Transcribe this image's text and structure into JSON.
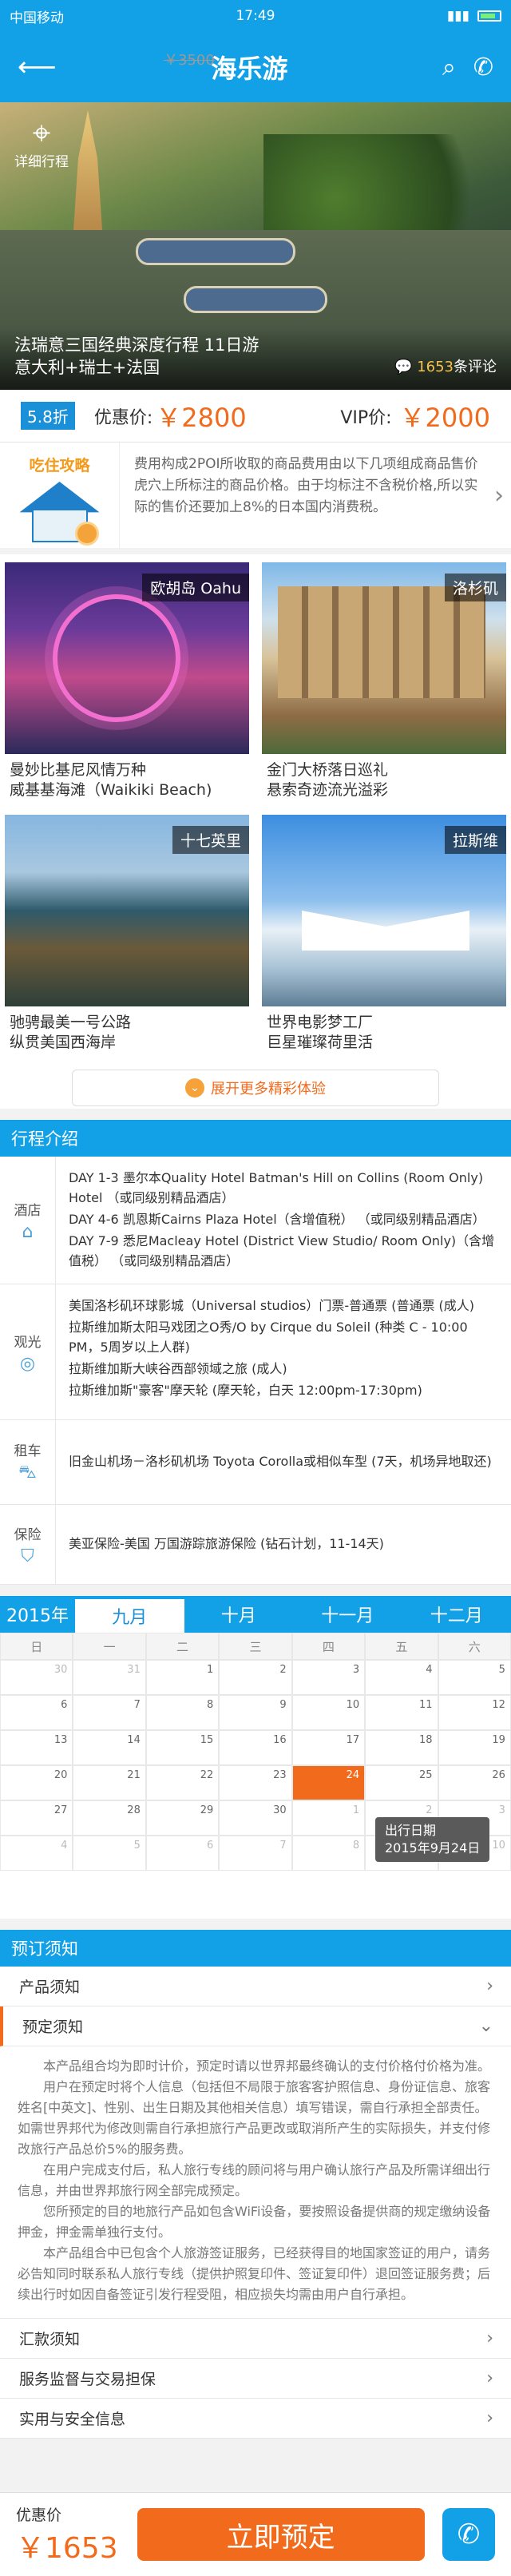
{
  "status": {
    "carrier": "中国移动",
    "time": "17:49"
  },
  "nav": {
    "title": "海乐游",
    "back_icon": "arrow-left-icon",
    "search_icon": "search-icon",
    "phone_icon": "phone-icon"
  },
  "hero": {
    "route_label": "详细行程",
    "title_line1": "法瑞意三国经典深度行程  11日游",
    "title_line2": "意大利+瑞士+法国",
    "comment_count": "1653",
    "comment_suffix": "条评论"
  },
  "price": {
    "discount": "5.8折",
    "deal_label": "优惠价:",
    "deal_price": "￥2800",
    "original_price": "￥3500",
    "vip_label": "VIP价:",
    "vip_price": "￥2000"
  },
  "tips": {
    "title": "吃住攻略",
    "text": "费用构成2POI所收取的商品费用由以下几项组成商品售价 虎穴上所标注的商品价格。由于均标注不含税价格,所以实际的售价还要加上8%的日本国内消费税。"
  },
  "highlights": [
    {
      "tag": "欧胡岛 Oahu",
      "line1": "曼妙比基尼风情万种",
      "line2": "威基基海滩（Waikiki Beach)"
    },
    {
      "tag": "洛杉矶",
      "line1": "金门大桥落日巡礼",
      "line2": "悬索奇迹流光溢彩"
    },
    {
      "tag": "十七英里",
      "line1": "驰骋最美一号公路",
      "line2": "纵贯美国西海岸"
    },
    {
      "tag": "拉斯维",
      "line1": "世界电影梦工厂",
      "line2": "巨星璀璨荷里活"
    }
  ],
  "more_label": "展开更多精彩体验",
  "itinerary": {
    "title": "行程介绍",
    "hotel": {
      "label": "酒店",
      "lines": [
        "DAY 1-3 墨尔本Quality Hotel Batman's Hill on Collins (Room Only) Hotel （或同级别精品酒店）",
        "DAY 4-6 凯恩斯Cairns Plaza Hotel（含增值税） （或同级别精品酒店）",
        "DAY 7-9 悉尼Macleay Hotel (District View Studio/ Room Only)（含增值税） （或同级别精品酒店）"
      ]
    },
    "sight": {
      "label": "观光",
      "lines": [
        "美国洛杉矶环球影城（Universal studios）门票-普通票 (普通票 (成人)",
        "拉斯维加斯太阳马戏团之O秀/O by Cirque du Soleil (种类 C - 10:00 PM，5周岁以上人群)",
        "拉斯维加斯大峡谷西部领域之旅 (成人)",
        "拉斯维加斯\"豪客\"摩天轮 (摩天轮，白天 12:00pm-17:30pm)"
      ]
    },
    "car": {
      "label": "租车",
      "lines": [
        "旧金山机场－洛杉矶机场 Toyota Corolla或相似车型 (7天，机场异地取还)"
      ]
    },
    "ins": {
      "label": "保险",
      "lines": [
        "美亚保险-美国 万国游踪旅游保险 (钻石计划，11-14天)"
      ]
    }
  },
  "calendar": {
    "year": "2015年",
    "months": [
      "九月",
      "十月",
      "十一月",
      "十二月"
    ],
    "weekdays": [
      "日",
      "一",
      "二",
      "三",
      "四",
      "五",
      "六"
    ],
    "rows": [
      [
        "30",
        "31",
        "1",
        "2",
        "3",
        "4",
        "5"
      ],
      [
        "6",
        "7",
        "8",
        "9",
        "10",
        "11",
        "12"
      ],
      [
        "13",
        "14",
        "15",
        "16",
        "17",
        "18",
        "19"
      ],
      [
        "20",
        "21",
        "22",
        "23",
        "24",
        "25",
        "26"
      ],
      [
        "27",
        "28",
        "29",
        "30",
        "1",
        "2",
        "3"
      ],
      [
        "4",
        "5",
        "6",
        "7",
        "8",
        "9",
        "10"
      ]
    ],
    "tooltip_line1": "出行日期",
    "tooltip_line2": "2015年9月24日"
  },
  "notes": {
    "title": "预订须知",
    "items": [
      "产品须知",
      "预定须知",
      "汇款须知",
      "服务监督与交易担保",
      "实用与安全信息"
    ],
    "body": [
      "本产品组合均为即时计价，预定时请以世界邦最终确认的支付价格付价格为准。",
      "用户在预定时将个人信息（包括但不局限于旅客客护照信息、身份证信息、旅客姓名[中英文]、性别、出生日期及其他相关信息）填写错误，需自行承担全部责任。如需世界邦代为修改则需自行承担旅行产品更改或取消所产生的实际损失，并支付修改旅行产品总价5%的服务费。",
      "在用户完成支付后，私人旅行专线的顾问将与用户确认旅行产品及所需详细出行信息，并由世界邦旅行网全部完成预定。",
      "您所预定的目的地旅行产品如包含WiFi设备，要按照设备提供商的规定缴纳设备押金，押金需单独行支付。",
      "本产品组合中已包含个人旅游签证服务，已经获得目的地国家签证的用户，请务必告知同时联系私人旅行专线（提供护照复印件、签证复印件）退回签证服务费；后续出行时如因自备签证引发行程受阻，相应损失均需由用户自行承担。"
    ]
  },
  "footer": {
    "price_label": "优惠价",
    "price": "￥1653",
    "book_label": "立即预定"
  }
}
